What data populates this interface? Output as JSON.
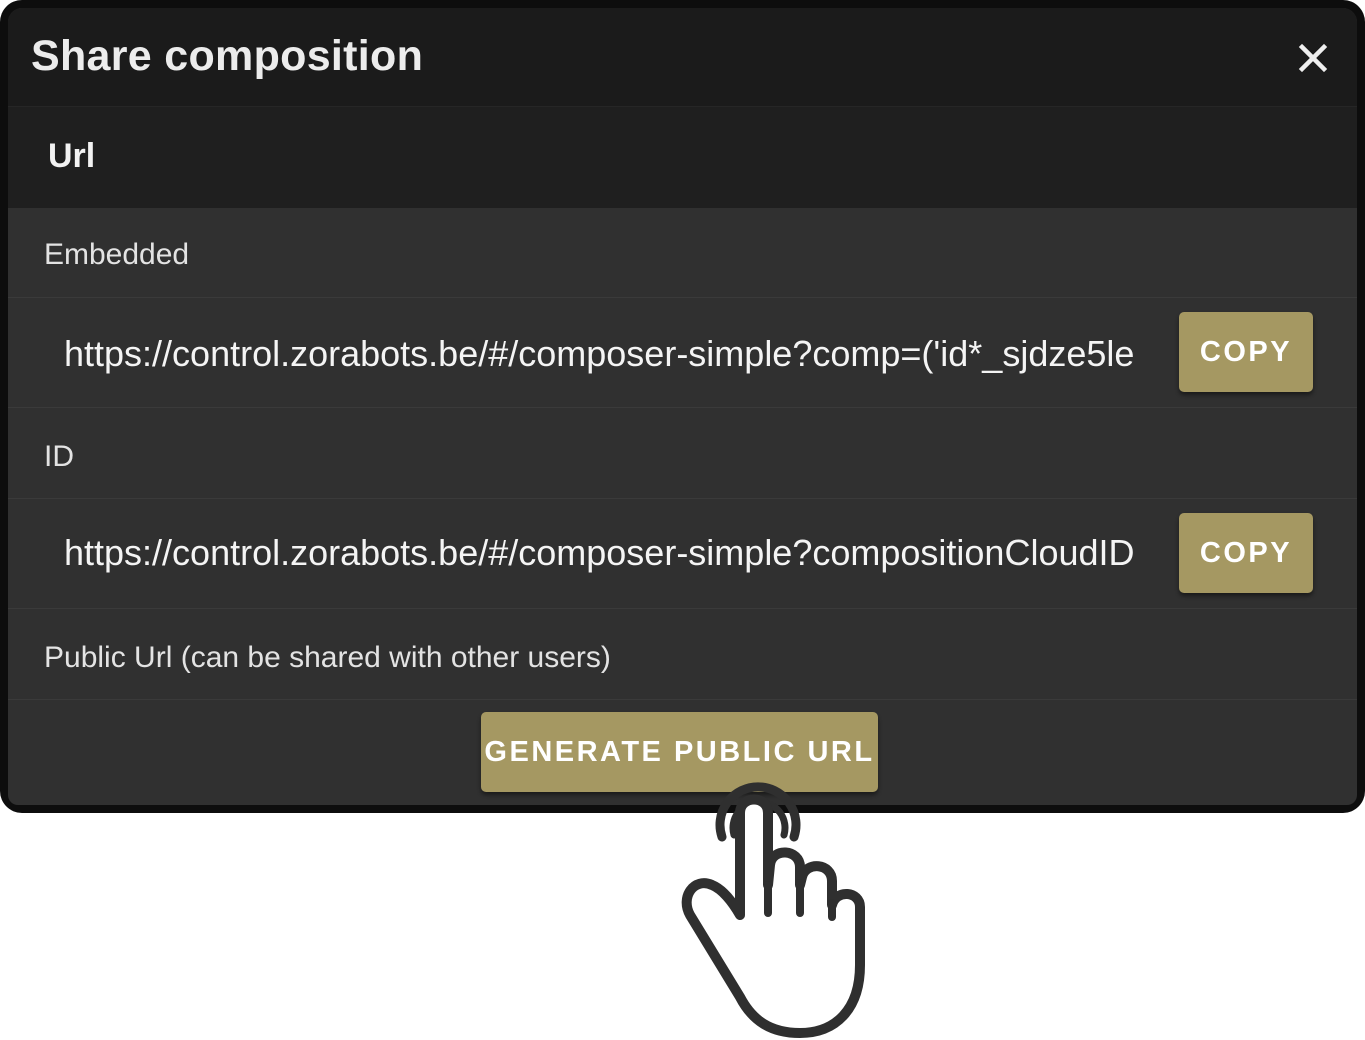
{
  "dialog": {
    "title": "Share composition",
    "close_icon": "close-icon"
  },
  "section": {
    "header": "Url"
  },
  "embedded": {
    "label": "Embedded",
    "url": "https://control.zorabots.be/#/composer-simple?comp=('id*_sjdze5le",
    "copy_label": "COPY"
  },
  "id": {
    "label": "ID",
    "url": "https://control.zorabots.be/#/composer-simple?compositionCloudID",
    "copy_label": "COPY"
  },
  "public": {
    "label": "Public Url (can be shared with other users)",
    "generate_label": "GENERATE PUBLIC URL"
  },
  "colors": {
    "accent": "#a59862",
    "dialog_bg": "#303030",
    "title_bg": "#1b1b1b"
  },
  "pointer_icon": "hand-pointer-icon"
}
